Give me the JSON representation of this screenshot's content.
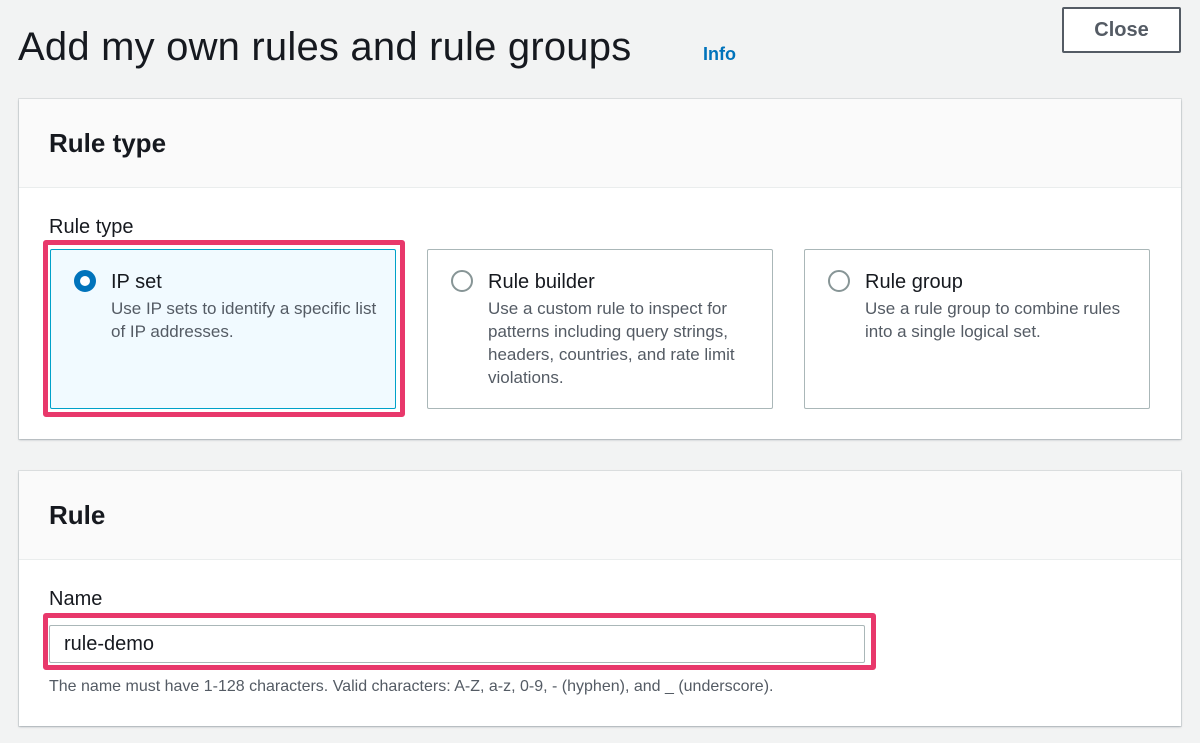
{
  "page": {
    "title": "Add my own rules and rule groups",
    "info_label": "Info",
    "close_label": "Close"
  },
  "rule_type_panel": {
    "header": "Rule type",
    "field_label": "Rule type",
    "options": [
      {
        "title": "IP set",
        "description": "Use IP sets to identify a specific list of IP addresses.",
        "selected": true
      },
      {
        "title": "Rule builder",
        "description": "Use a custom rule to inspect for patterns including query strings, headers, countries, and rate limit violations.",
        "selected": false
      },
      {
        "title": "Rule group",
        "description": "Use a rule group to combine rules into a single logical set.",
        "selected": false
      }
    ]
  },
  "rule_panel": {
    "header": "Rule",
    "name_label": "Name",
    "name_value": "rule-demo",
    "name_constraint": "The name must have 1-128 characters. Valid characters: A-Z, a-z, 0-9, - (hyphen), and _ (underscore)."
  },
  "colors": {
    "accent": "#0073bb",
    "highlight": "#e8386b",
    "selected_tile_bg": "#f1faff"
  }
}
